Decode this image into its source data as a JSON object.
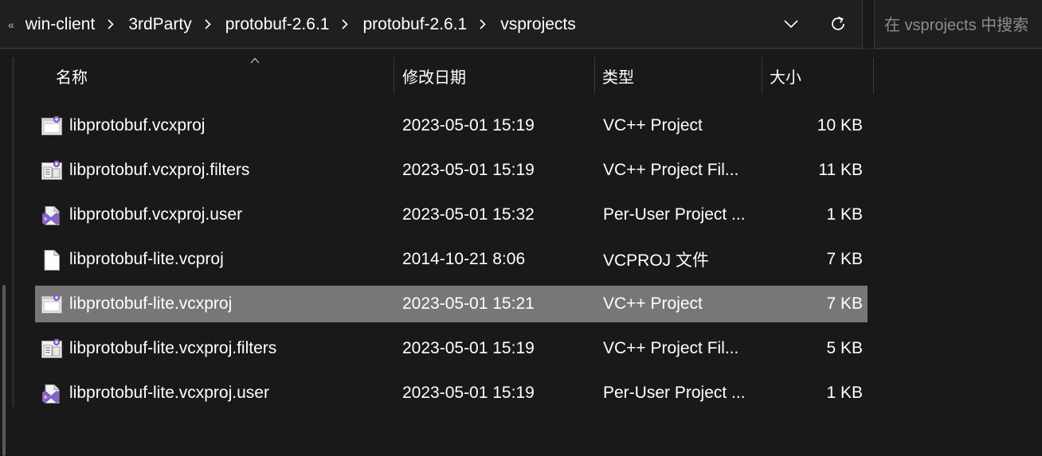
{
  "address_bar": {
    "overflow_glyph": "«",
    "breadcrumbs": [
      "win-client",
      "3rdParty",
      "protobuf-2.6.1",
      "protobuf-2.6.1",
      "vsprojects"
    ]
  },
  "search": {
    "placeholder": "在 vsprojects 中搜索"
  },
  "columns": {
    "name": "名称",
    "date": "修改日期",
    "type": "类型",
    "size": "大小"
  },
  "files": [
    {
      "name": "libprotobuf.vcxproj",
      "date": "2023-05-01 15:19",
      "type": "VC++ Project",
      "size": "10 KB",
      "icon": "vcxproj-icon"
    },
    {
      "name": "libprotobuf.vcxproj.filters",
      "date": "2023-05-01 15:19",
      "type": "VC++ Project Fil...",
      "size": "11 KB",
      "icon": "filters-icon"
    },
    {
      "name": "libprotobuf.vcxproj.user",
      "date": "2023-05-01 15:32",
      "type": "Per-User Project ...",
      "size": "1 KB",
      "icon": "visual-studio-icon"
    },
    {
      "name": "libprotobuf-lite.vcproj",
      "date": "2014-10-21 8:06",
      "type": "VCPROJ 文件",
      "size": "7 KB",
      "icon": "blank-file-icon"
    },
    {
      "name": "libprotobuf-lite.vcxproj",
      "date": "2023-05-01 15:21",
      "type": "VC++ Project",
      "size": "7 KB",
      "icon": "vcxproj-icon",
      "selected": true
    },
    {
      "name": "libprotobuf-lite.vcxproj.filters",
      "date": "2023-05-01 15:19",
      "type": "VC++ Project Fil...",
      "size": "5 KB",
      "icon": "filters-icon"
    },
    {
      "name": "libprotobuf-lite.vcxproj.user",
      "date": "2023-05-01 15:19",
      "type": "Per-User Project ...",
      "size": "1 KB",
      "icon": "visual-studio-icon"
    }
  ],
  "colors": {
    "background": "#191919",
    "selection": "#777777",
    "vs_purple": "#8661c5"
  }
}
